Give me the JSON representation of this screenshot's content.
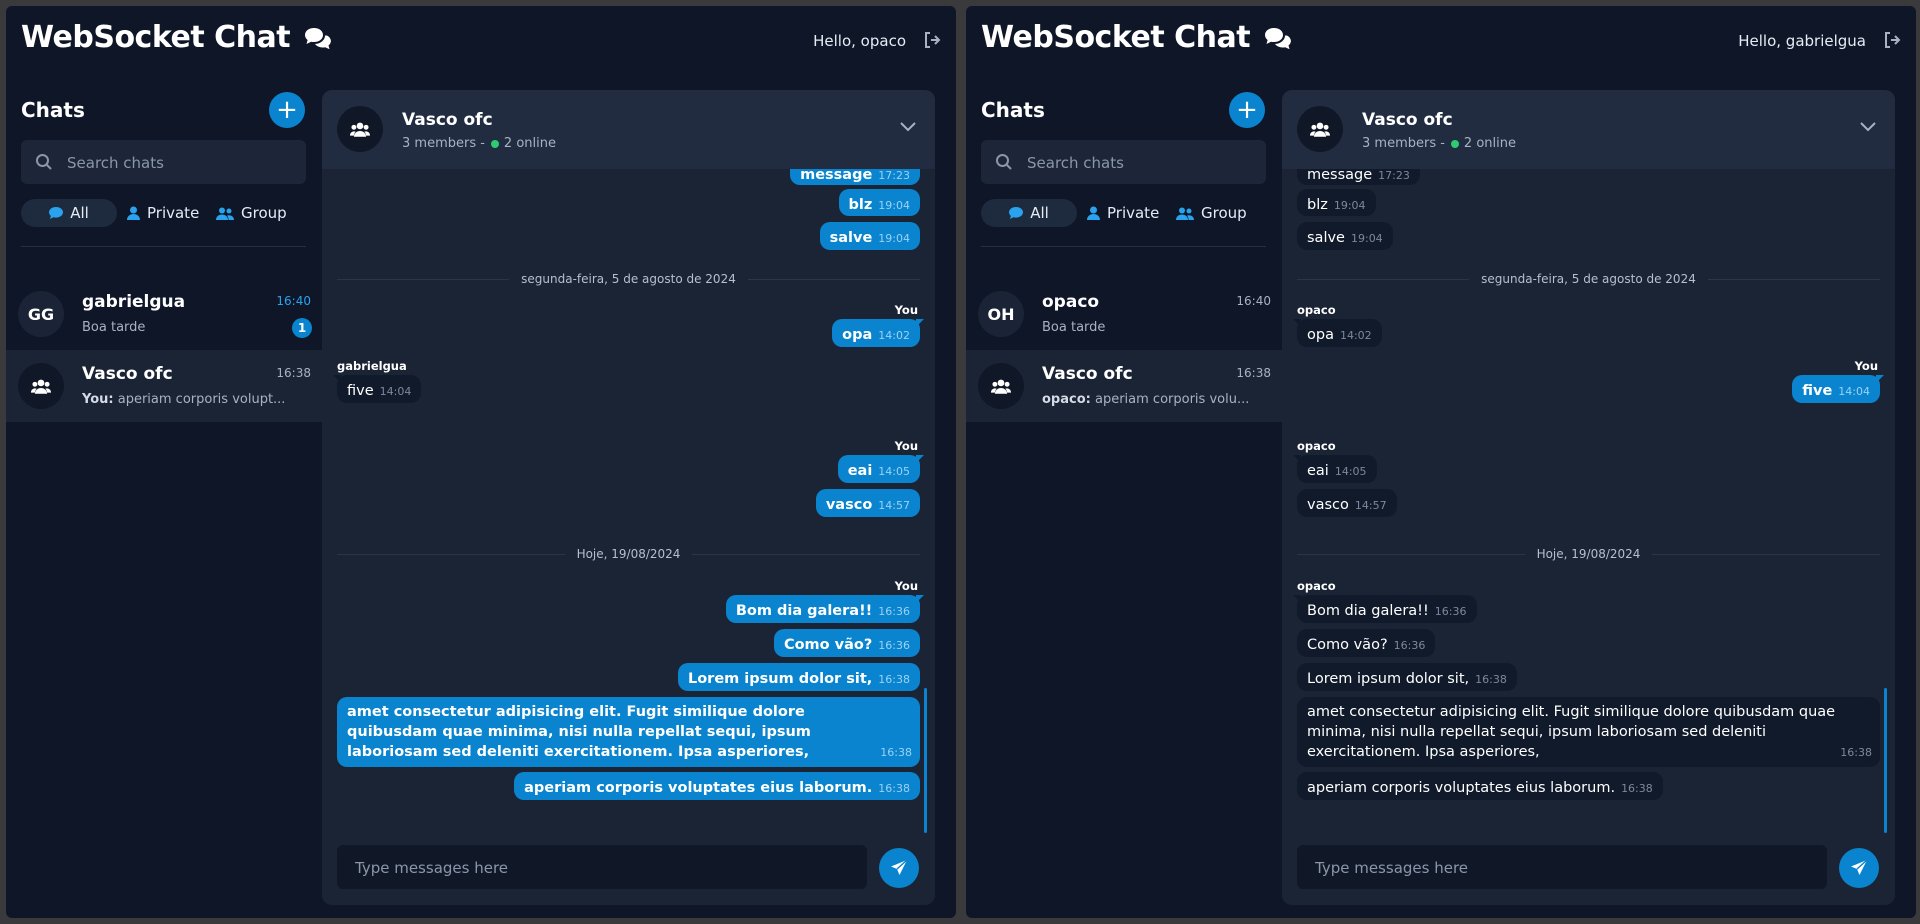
{
  "colors": {
    "accent": "#0a84ce",
    "online": "#2ecc71",
    "background": "#0e1628"
  },
  "left": {
    "brand": "WebSocket Chat",
    "greeting": "Hello, opaco",
    "chats_title": "Chats",
    "search_placeholder": "Search chats",
    "filters": [
      "All",
      "Private",
      "Group"
    ],
    "chat_list": [
      {
        "avatar": "GG",
        "name": "gabrielgua",
        "preview": "Boa tarde",
        "time": "16:40",
        "badge": "1"
      },
      {
        "name": "Vasco ofc",
        "preview_sender": "You:",
        "preview": "aperiam corporis volupt...",
        "time": "16:38"
      }
    ],
    "header": {
      "name": "Vasco ofc",
      "members": "3 members -",
      "online": "2 online"
    },
    "messages": [
      {
        "text": "message",
        "time": "17:23"
      },
      {
        "text": "blz",
        "time": "19:04"
      },
      {
        "text": "salve",
        "time": "19:04"
      },
      {
        "day": "segunda-feira, 5 de agosto de 2024"
      },
      {
        "sender": "You"
      },
      {
        "text": "opa",
        "time": "14:02"
      },
      {
        "sender": "gabrielgua"
      },
      {
        "text": "five",
        "time": "14:04"
      },
      {
        "sender": "You"
      },
      {
        "text": "eai",
        "time": "14:05"
      },
      {
        "text": "vasco",
        "time": "14:57"
      },
      {
        "day": "Hoje, 19/08/2024"
      },
      {
        "sender": "You"
      },
      {
        "text": "Bom dia galera!!",
        "time": "16:36"
      },
      {
        "text": "Como vão?",
        "time": "16:36"
      },
      {
        "text": "Lorem ipsum dolor sit,",
        "time": "16:38"
      },
      {
        "text": "amet consectetur adipisicing elit. Fugit similique dolore quibusdam quae minima, nisi nulla repellat sequi, ipsum laboriosam sed deleniti exercitationem. Ipsa asperiores,",
        "time": "16:38"
      },
      {
        "text": "aperiam corporis voluptates eius laborum.",
        "time": "16:38"
      }
    ],
    "composer_placeholder": "Type messages here"
  },
  "right": {
    "brand": "WebSocket Chat",
    "greeting": "Hello, gabrielgua",
    "chats_title": "Chats",
    "search_placeholder": "Search chats",
    "filters": [
      "All",
      "Private",
      "Group"
    ],
    "chat_list": [
      {
        "avatar": "OH",
        "name": "opaco",
        "preview": "Boa tarde",
        "time": "16:40"
      },
      {
        "name": "Vasco ofc",
        "preview_sender": "opaco:",
        "preview": "aperiam corporis volu...",
        "time": "16:38"
      }
    ],
    "header": {
      "name": "Vasco ofc",
      "members": "3 members -",
      "online": "2 online"
    },
    "messages": [
      {
        "text": "message",
        "time": "17:23"
      },
      {
        "text": "blz",
        "time": "19:04"
      },
      {
        "text": "salve",
        "time": "19:04"
      },
      {
        "day": "segunda-feira, 5 de agosto de 2024"
      },
      {
        "sender": "opaco"
      },
      {
        "text": "opa",
        "time": "14:02"
      },
      {
        "sender": "You"
      },
      {
        "text": "five",
        "time": "14:04"
      },
      {
        "sender": "opaco"
      },
      {
        "text": "eai",
        "time": "14:05"
      },
      {
        "text": "vasco",
        "time": "14:57"
      },
      {
        "day": "Hoje, 19/08/2024"
      },
      {
        "sender": "opaco"
      },
      {
        "text": "Bom dia galera!!",
        "time": "16:36"
      },
      {
        "text": "Como vão?",
        "time": "16:36"
      },
      {
        "text": "Lorem ipsum dolor sit,",
        "time": "16:38"
      },
      {
        "text": "amet consectetur adipisicing elit. Fugit similique dolore quibusdam quae minima, nisi nulla repellat sequi, ipsum laboriosam sed deleniti exercitationem. Ipsa asperiores,",
        "time": "16:38"
      },
      {
        "text": "aperiam corporis voluptates eius laborum.",
        "time": "16:38"
      }
    ],
    "composer_placeholder": "Type messages here"
  }
}
